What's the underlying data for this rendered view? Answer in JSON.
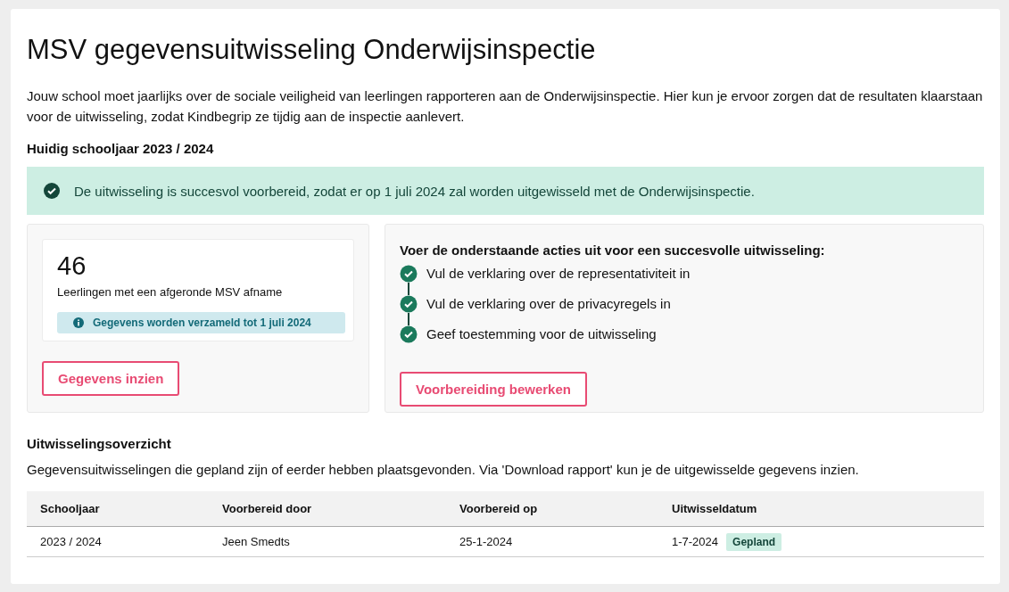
{
  "title": "MSV gegevensuitwisseling Onderwijsinspectie",
  "intro": "Jouw school moet jaarlijks over de sociale veiligheid van leerlingen rapporteren aan de Onderwijsinspectie. Hier kun je ervoor zorgen dat de resultaten klaarstaan voor de uitwisseling, zodat Kindbegrip ze tijdig aan de inspectie aanlevert.",
  "current_year_heading": "Huidig schooljaar 2023 / 2024",
  "success_alert": "De uitwisseling is succesvol voorbereid, zodat er op 1 juli 2024 zal worden uitgewisseld met de Onderwijsinspectie.",
  "stat": {
    "value": "46",
    "label": "Leerlingen met een afgeronde MSV afname",
    "info": "Gegevens worden verzameld tot 1 juli 2024",
    "button": "Gegevens inzien"
  },
  "actions": {
    "heading": "Voer de onderstaande acties uit voor een succesvolle uitwisseling:",
    "steps": [
      {
        "label": "Vul de verklaring over de representativiteit in",
        "done": true
      },
      {
        "label": "Vul de verklaring over de privacyregels in",
        "done": true
      },
      {
        "label": "Geef toestemming voor de uitwisseling",
        "done": true
      }
    ],
    "button": "Voorbereiding bewerken"
  },
  "overview": {
    "heading": "Uitwisselingsoverzicht",
    "description": "Gegevensuitwisselingen die gepland zijn of eerder hebben plaatsgevonden. Via 'Download rapport' kun je de uitgewisselde gegevens inzien.",
    "columns": [
      "Schooljaar",
      "Voorbereid door",
      "Voorbereid op",
      "Uitwisseldatum"
    ],
    "rows": [
      {
        "cells": [
          "2023 / 2024",
          "Jeen Smedts",
          "25-1-2024",
          "1-7-2024"
        ],
        "status": "Gepland"
      }
    ]
  }
}
